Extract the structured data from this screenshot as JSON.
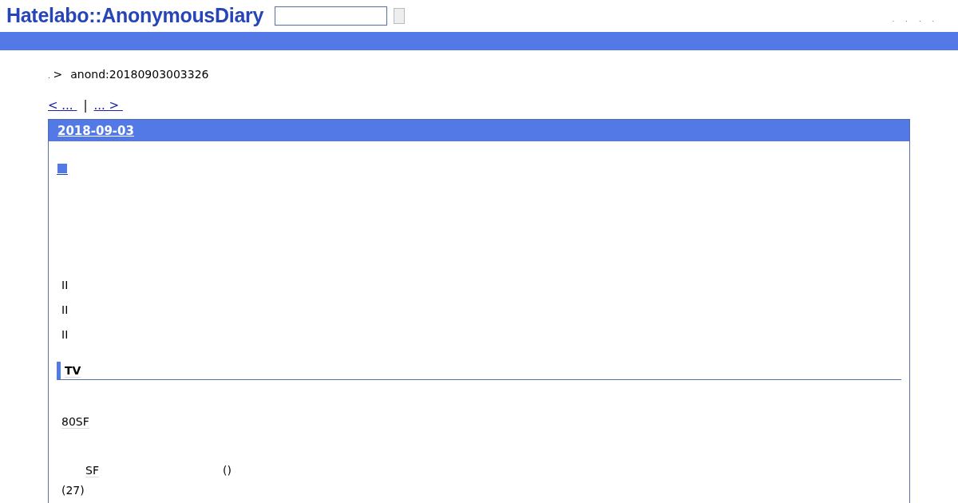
{
  "header": {
    "logo": "Hatelabo::AnonymousDiary",
    "links": [
      ".",
      ".",
      ".",
      "."
    ]
  },
  "breadcrumb": {
    "home": ".",
    "separator": ">",
    "current": "anond:20180903003326"
  },
  "pager": {
    "prev": "< ... ",
    "separator": "|",
    "next": "... > "
  },
  "day": {
    "date": "2018-09-03",
    "blocks": [
      {
        "kind": "mark"
      },
      {
        "kind": "para",
        "text": "II"
      },
      {
        "kind": "para",
        "text": "II"
      },
      {
        "kind": "para",
        "text": "II"
      },
      {
        "kind": "heading",
        "text": "TV"
      },
      {
        "kind": "keyword",
        "text": "80SF"
      },
      {
        "kind": "row",
        "texts": [
          "SF",
          "()"
        ]
      },
      {
        "kind": "para",
        "text": "(27)"
      }
    ]
  }
}
